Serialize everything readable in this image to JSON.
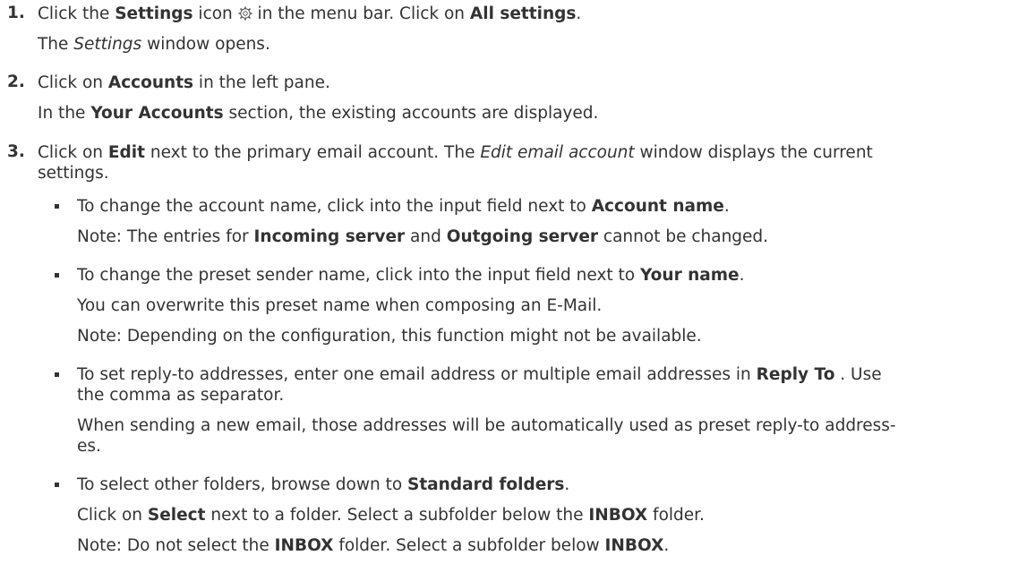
{
  "steps": [
    {
      "number": "1.",
      "text_a": "Click the ",
      "b1": "Settings",
      "text_b": " icon ",
      "icon": "gear-icon",
      "text_c": " in the menu bar. Click on ",
      "b2": "All settings",
      "text_d": ".",
      "result_a": "The ",
      "result_i": "Settings",
      "result_b": " window opens."
    },
    {
      "number": "2.",
      "text_a": "Click on ",
      "b1": "Accounts",
      "text_b": " in the left pane.",
      "result_a": "In the ",
      "result_b1": "Your Accounts",
      "result_b": " section, the existing accounts are displayed."
    },
    {
      "number": "3.",
      "text_a": "Click on ",
      "b1": "Edit",
      "text_b": " next to the primary email account. The ",
      "i1": "Edit email account",
      "text_c": " window displays the current",
      "text_d": "settings."
    }
  ],
  "bullets": [
    {
      "l1_a": "To change the account name, click into the input field next to ",
      "l1_b": "Account name",
      "l1_c": ".",
      "l2_a": "Note: The entries for ",
      "l2_b1": "Incoming server",
      "l2_c": " and ",
      "l2_b2": "Outgoing server",
      "l2_d": " cannot be changed."
    },
    {
      "l1_a": "To change the preset sender name, click into the input field next to ",
      "l1_b": "Your name",
      "l1_c": ".",
      "l2": "You can overwrite this preset name when composing an E-Mail.",
      "l3": "Note: Depending on the configuration, this function might not be available."
    },
    {
      "l1_a": "To set reply-to addresses, enter one email address or multiple email addresses in ",
      "l1_b": "Reply To",
      "l1_c": " . Use",
      "l2": "the comma as separator.",
      "l3": "When sending a new email, those addresses will be automatically used as preset reply-to address-",
      "l4": "es."
    },
    {
      "l1_a": "To select other folders, browse down to ",
      "l1_b": "Standard folders",
      "l1_c": ".",
      "l2_a": "Click on ",
      "l2_b1": "Select",
      "l2_c": " next to a folder. Select a subfolder below the ",
      "l2_b2": "INBOX",
      "l2_d": " folder.",
      "l3_a": "Note: Do not select the ",
      "l3_b1": "INBOX",
      "l3_c": " folder. Select a subfolder below ",
      "l3_b2": "INBOX",
      "l3_d": "."
    }
  ]
}
